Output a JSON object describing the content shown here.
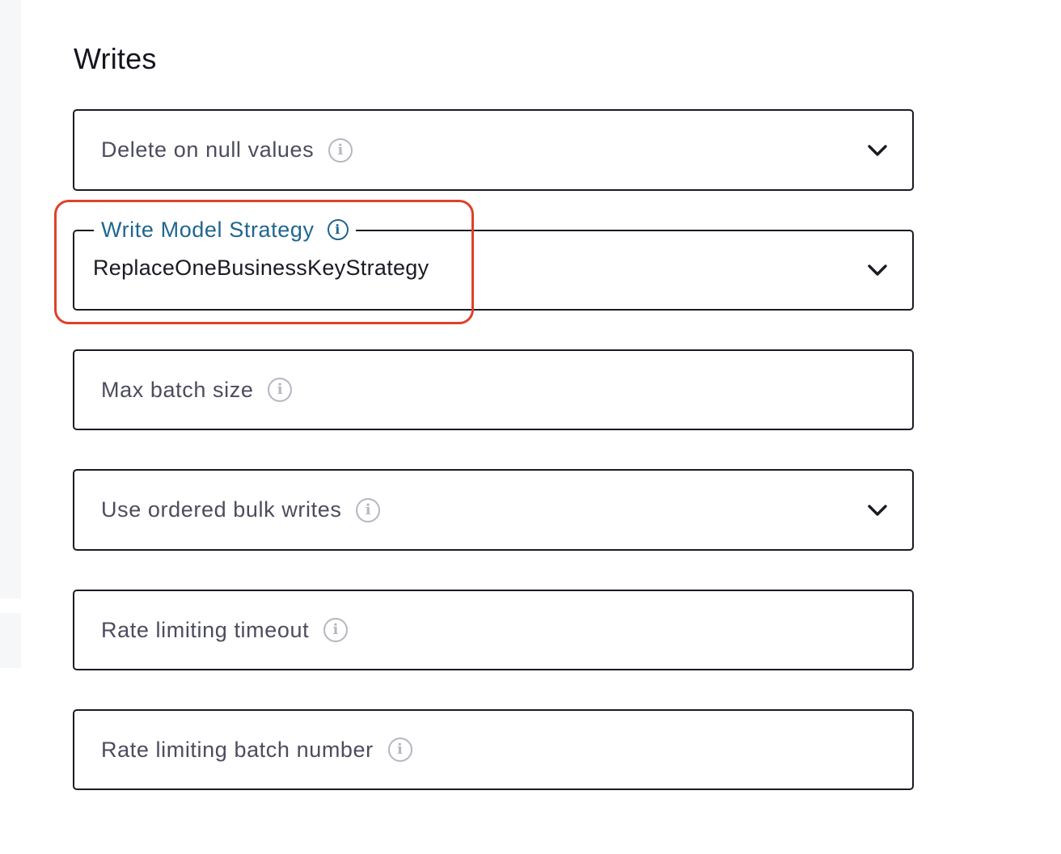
{
  "section": {
    "title": "Writes"
  },
  "fields": [
    {
      "label": "Delete on null values",
      "info_icon": "info-icon",
      "has_dropdown": true
    },
    {
      "label": "Write Model Strategy",
      "info_icon": "info-icon",
      "has_dropdown": true,
      "value": "ReplaceOneBusinessKeyStrategy",
      "focused": true
    },
    {
      "label": "Max batch size",
      "info_icon": "info-icon",
      "has_dropdown": false
    },
    {
      "label": "Use ordered bulk writes",
      "info_icon": "info-icon",
      "has_dropdown": true
    },
    {
      "label": "Rate limiting timeout",
      "info_icon": "info-icon",
      "has_dropdown": false
    },
    {
      "label": "Rate limiting batch number",
      "info_icon": "info-icon",
      "has_dropdown": false
    }
  ],
  "icons": {
    "info": "i",
    "dropdown": "chevron-down-icon"
  },
  "colors": {
    "focused_label": "#1f6690",
    "highlight": "#e0402a",
    "border": "#1a1a24",
    "label": "#4c4c5e"
  }
}
